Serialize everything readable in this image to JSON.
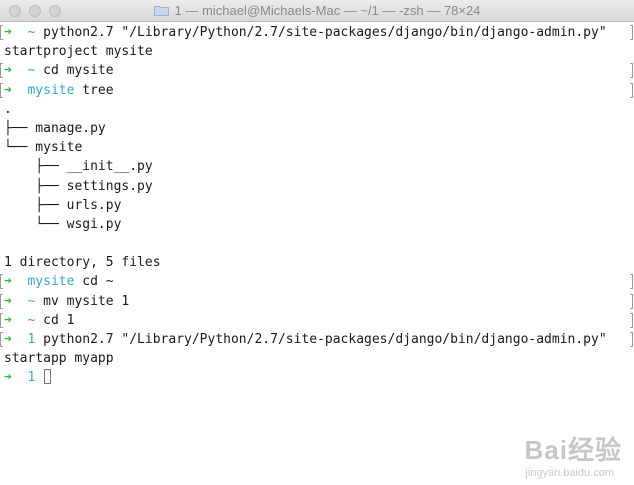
{
  "window": {
    "title": "1 — michael@Michaels-Mac — ~/1 — -zsh — 78×24"
  },
  "terminal": {
    "prompt_arrow": "➜",
    "lines": [
      {
        "kind": "prompt",
        "dir": "~",
        "cmd": "python2.7 \"/Library/Python/2.7/site-packages/django/bin/django-admin.py\""
      },
      {
        "kind": "output",
        "text": "startproject mysite"
      },
      {
        "kind": "prompt",
        "dir": "~",
        "cmd": "cd mysite"
      },
      {
        "kind": "prompt",
        "dir": "mysite",
        "cmd": "tree"
      },
      {
        "kind": "output",
        "text": "."
      },
      {
        "kind": "output",
        "text": "├── manage.py"
      },
      {
        "kind": "output",
        "text": "└── mysite"
      },
      {
        "kind": "output",
        "text": "    ├── __init__.py"
      },
      {
        "kind": "output",
        "text": "    ├── settings.py"
      },
      {
        "kind": "output",
        "text": "    ├── urls.py"
      },
      {
        "kind": "output",
        "text": "    └── wsgi.py"
      },
      {
        "kind": "output",
        "text": ""
      },
      {
        "kind": "output",
        "text": "1 directory, 5 files"
      },
      {
        "kind": "prompt",
        "dir": "mysite",
        "cmd": "cd ~"
      },
      {
        "kind": "prompt",
        "dir": "~",
        "cmd": "mv mysite 1"
      },
      {
        "kind": "prompt",
        "dir": "~",
        "cmd": "cd 1"
      },
      {
        "kind": "prompt",
        "dir": "1",
        "cmd": "python2.7 \"/Library/Python/2.7/site-packages/django/bin/django-admin.py\""
      },
      {
        "kind": "output",
        "text": "startapp myapp"
      },
      {
        "kind": "current",
        "dir": "1",
        "cmd": ""
      }
    ]
  },
  "watermark": {
    "brand": "Bai经验",
    "url": "jingyan.baidu.com"
  },
  "colors": {
    "arrow": "#2fbf3b",
    "dir": "#35a9c9",
    "text": "#1a1a1a"
  }
}
